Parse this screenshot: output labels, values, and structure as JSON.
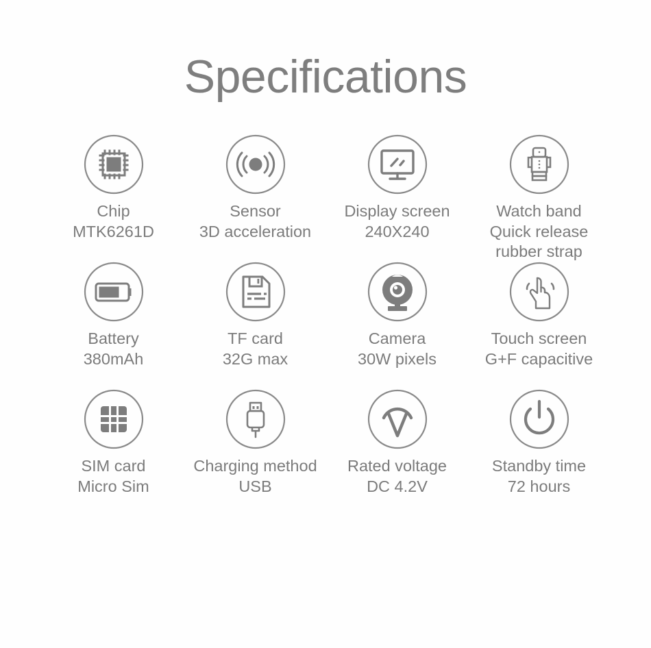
{
  "page": {
    "title": "Specifications",
    "accent_color": "#7d7d7d",
    "circle_stroke_color": "#8a8a8a",
    "icon_color": "#7d7d7d",
    "background_color": "#ffffff"
  },
  "specs": [
    {
      "icon": "chip-icon",
      "line1": "Chip",
      "line2": "MTK6261D",
      "line3": ""
    },
    {
      "icon": "sensor-signal-icon",
      "line1": "Sensor",
      "line2": "3D acceleration",
      "line3": ""
    },
    {
      "icon": "display-monitor-icon",
      "line1": "Display screen",
      "line2": "240X240",
      "line3": ""
    },
    {
      "icon": "watch-band-icon",
      "line1": "Watch band",
      "line2": "Quick release",
      "line3": "rubber strap"
    },
    {
      "icon": "battery-icon",
      "line1": "Battery",
      "line2": "380mAh",
      "line3": ""
    },
    {
      "icon": "tf-card-icon",
      "line1": "TF card",
      "line2": "32G max",
      "line3": ""
    },
    {
      "icon": "camera-icon",
      "line1": "Camera",
      "line2": "30W pixels",
      "line3": ""
    },
    {
      "icon": "touch-hand-icon",
      "line1": "Touch screen",
      "line2": "G+F capacitive",
      "line3": ""
    },
    {
      "icon": "sim-card-icon",
      "line1": "SIM card",
      "line2": "Micro Sim",
      "line3": ""
    },
    {
      "icon": "usb-plug-icon",
      "line1": "Charging method",
      "line2": "USB",
      "line3": ""
    },
    {
      "icon": "voltage-icon",
      "line1": "Rated voltage",
      "line2": "DC 4.2V",
      "line3": ""
    },
    {
      "icon": "power-standby-icon",
      "line1": "Standby time",
      "line2": "72 hours",
      "line3": ""
    }
  ]
}
